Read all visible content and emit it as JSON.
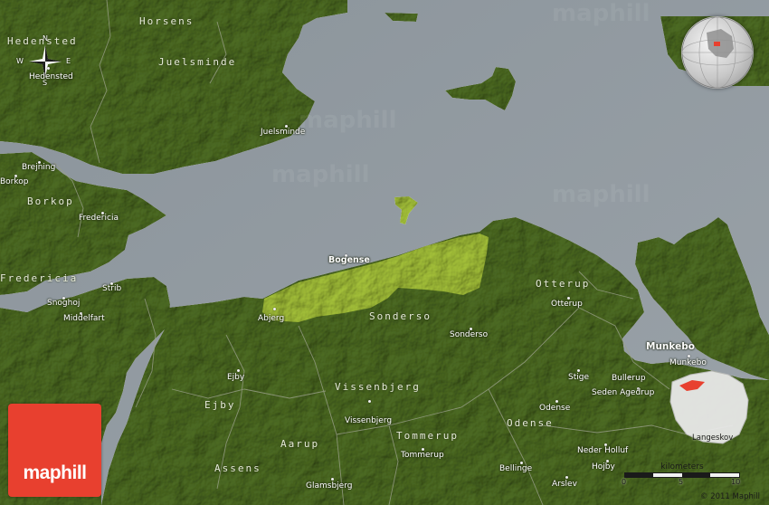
{
  "map": {
    "colors": {
      "water": "#8e979e",
      "land": "#4c6b22",
      "highlight": "#a8c83a",
      "border": "#8a8f7c",
      "logo": "#e8402f"
    },
    "labels": {
      "horsens": "Horsens",
      "hedensted_region": "Hedensted",
      "hedensted": "Hedensted",
      "juelsminde_region": "Juelsminde",
      "juelsminde": "Juelsminde",
      "brejning": "Brejning",
      "borkop": "Borkop",
      "borkop_region": "Borkop",
      "fredericia_city": "Fredericia",
      "fredericia_region": "Fredericia",
      "strib": "Strib",
      "snoghoj": "Snoghoj",
      "middelfart": "Middelfart",
      "bogense": "Bogense",
      "abjerg": "Abjerg",
      "sonderso_region": "Sonderso",
      "sonderso": "Sonderso",
      "otterup_region": "Otterup",
      "otterup": "Otterup",
      "munkebo_region": "Munkebo",
      "munkebo": "Munkebo",
      "ejby": "Ejby",
      "ejby_region": "Ejby",
      "vissenbjerg_region": "Vissenbjerg",
      "vissenbjerg": "Vissenbjerg",
      "aarup": "Aarup",
      "assens": "Assens",
      "tommerup_region": "Tommerup",
      "tommerup": "Tommerup",
      "glamsbjerg": "Glamsbjerg",
      "odense_region": "Odense",
      "odense": "Odense",
      "stige": "Stige",
      "bullerup": "Bullerup",
      "seden_agedrup": "Seden Agedrup",
      "neder_holluf": "Neder Holluf",
      "hojby": "Hojby",
      "bellinge": "Bellinge",
      "arslev": "Arslev",
      "langeskov": "Langeskov"
    },
    "compass": {
      "n": "N",
      "s": "S",
      "w": "W",
      "e": "E"
    },
    "watermark": "maphill",
    "logo_text": "maphill",
    "scale": {
      "title": "kilometers",
      "ticks": [
        "0",
        "5",
        "10"
      ]
    },
    "copyright": "© 2011 Maphill"
  }
}
